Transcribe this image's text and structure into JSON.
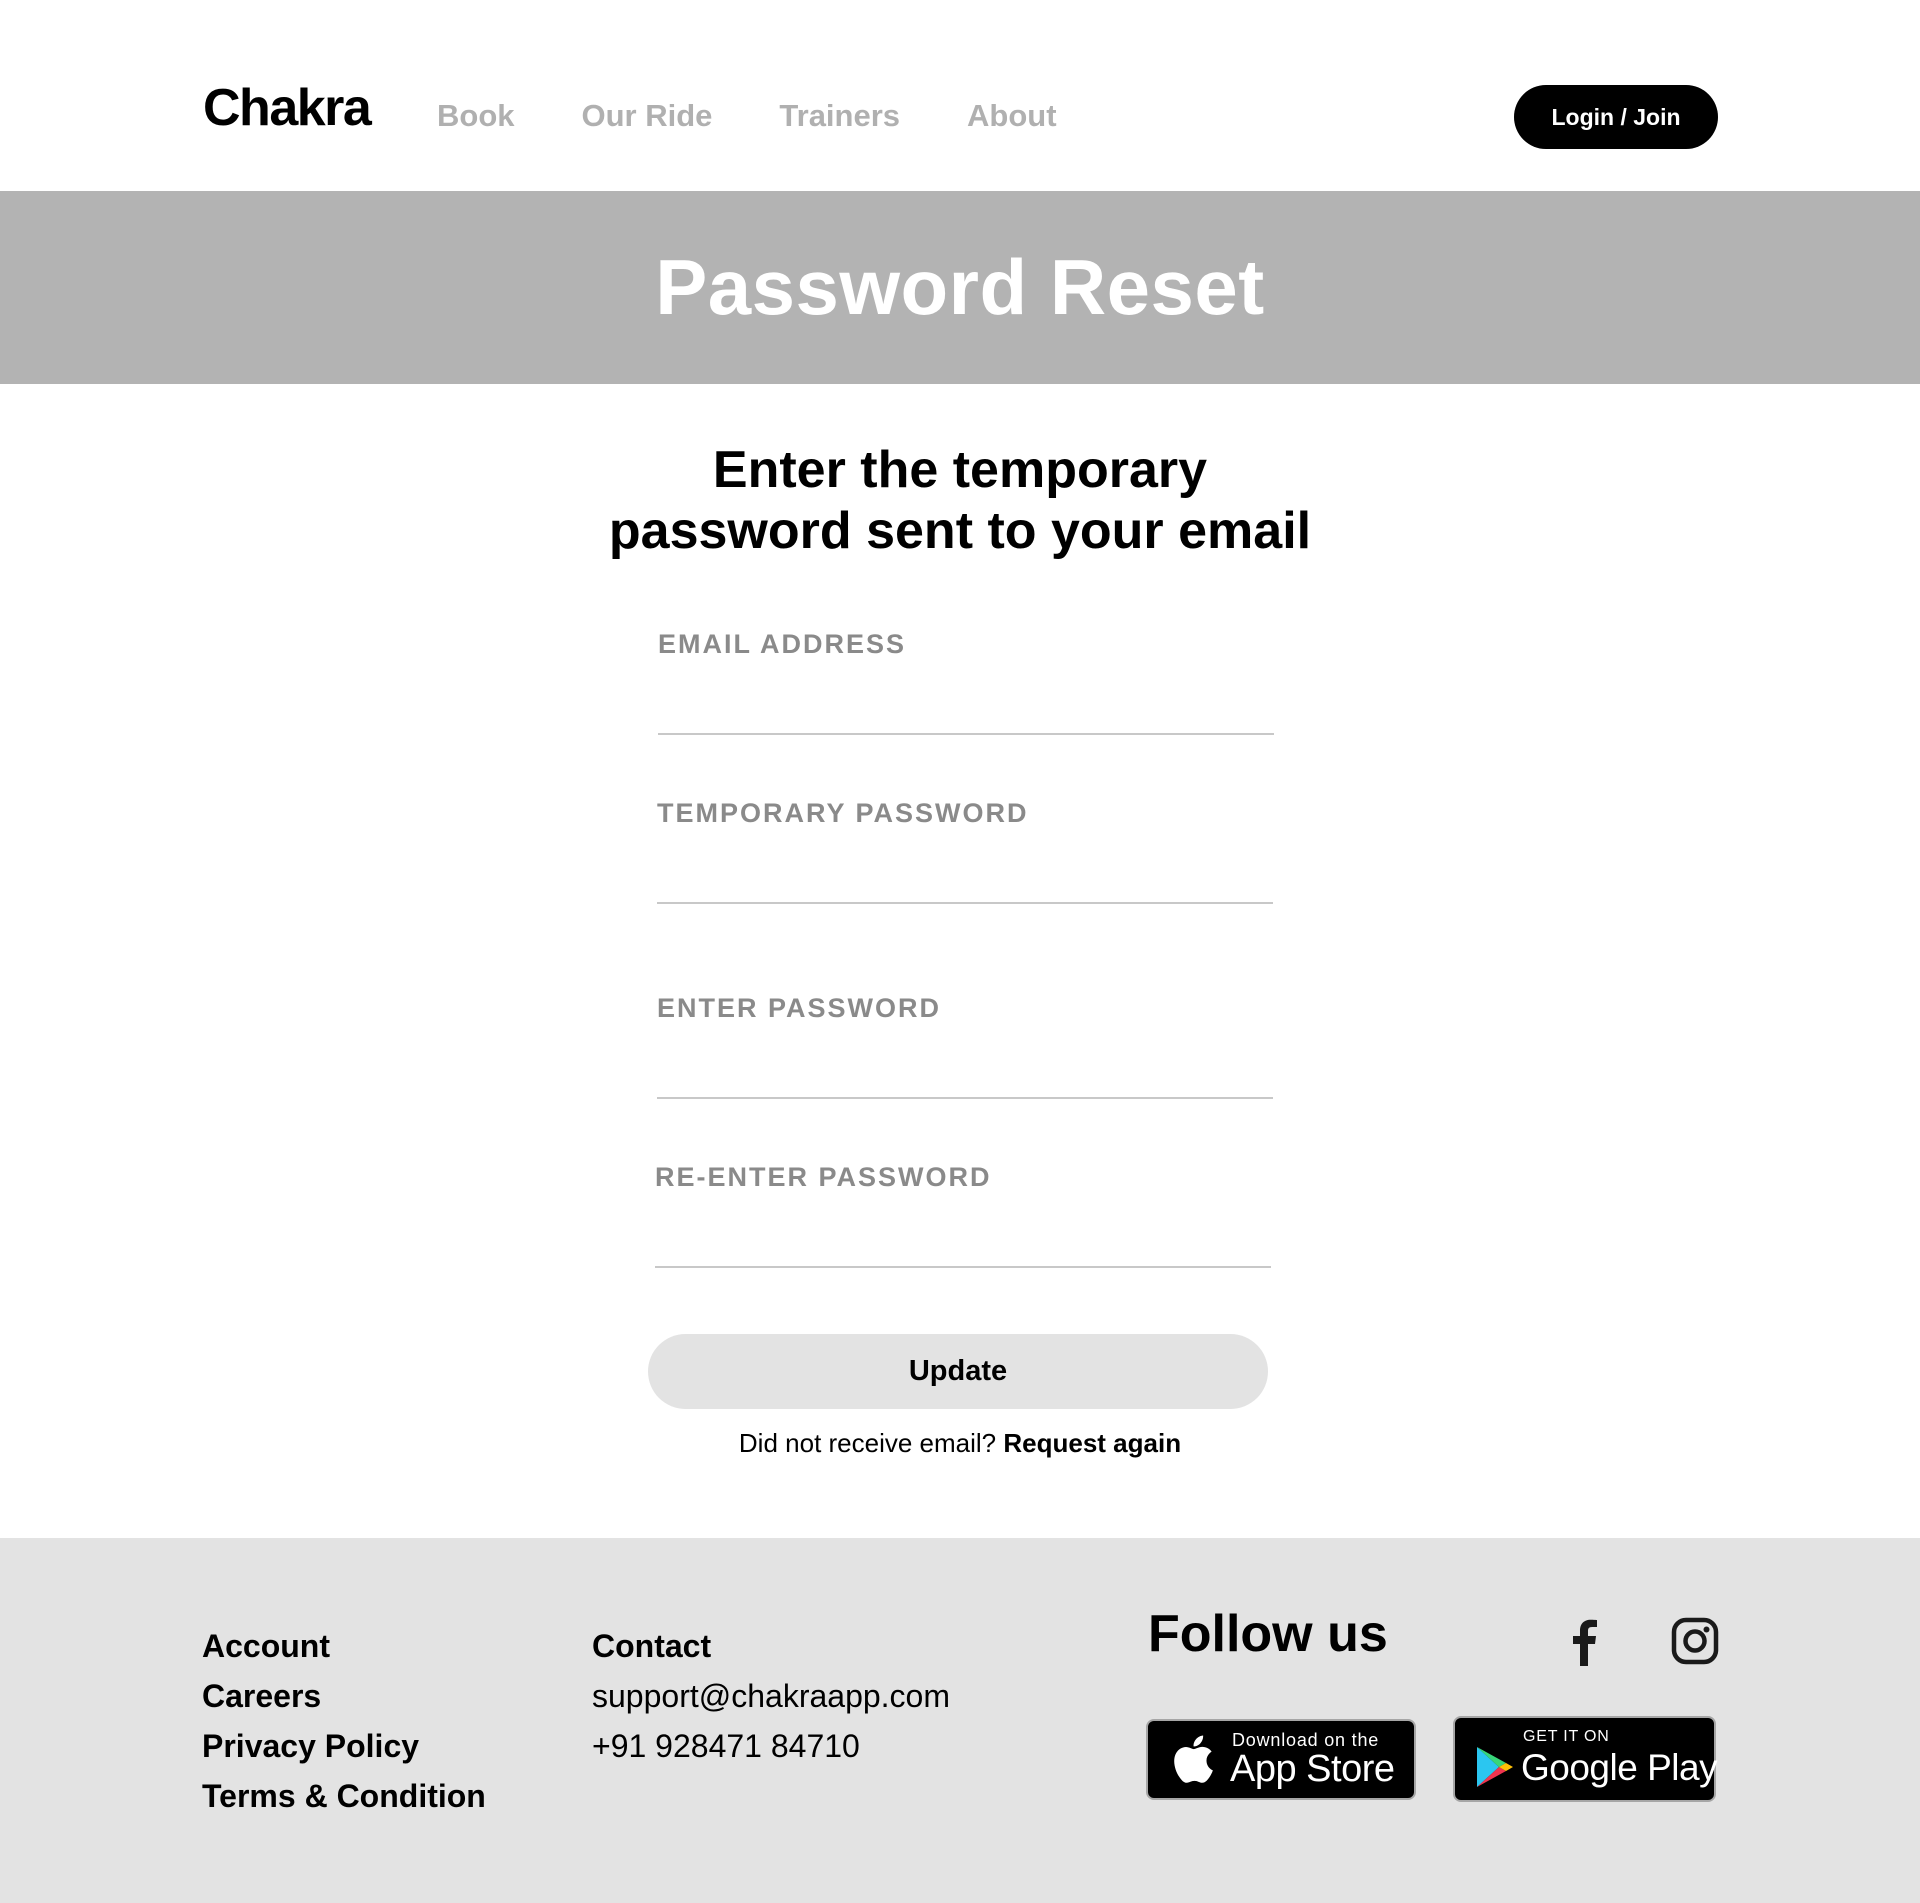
{
  "header": {
    "logo": "Chakra",
    "nav": [
      "Book",
      "Our Ride",
      "Trainers",
      "About"
    ],
    "login_label": "Login / Join"
  },
  "hero": {
    "title": "Password Reset"
  },
  "form": {
    "subtitle_line1": "Enter the temporary",
    "subtitle_line2": "password sent to your email",
    "fields": [
      {
        "label": "EMAIL ADDRESS",
        "value": ""
      },
      {
        "label": "TEMPORARY PASSWORD",
        "value": ""
      },
      {
        "label": "ENTER PASSWORD",
        "value": ""
      },
      {
        "label": "RE-ENTER PASSWORD",
        "value": ""
      }
    ],
    "submit_label": "Update",
    "resend_text": "Did not receive email?",
    "resend_link": "Request again"
  },
  "footer": {
    "account_links": [
      "Account",
      "Careers",
      "Privacy Policy",
      "Terms & Condition"
    ],
    "contact_heading": "Contact",
    "contact_email": "support@chakraapp.com",
    "contact_phone": "+91 928471 84710",
    "follow_heading": "Follow us",
    "social_icons": [
      "facebook-icon",
      "instagram-icon"
    ],
    "app_store": {
      "small": "Download on the",
      "big": "App Store"
    },
    "google_play": {
      "small": "GET IT ON",
      "big": "Google Play"
    }
  },
  "colors": {
    "hero_bg": "#b3b3b3",
    "footer_bg": "#e3e3e3",
    "nav_inactive": "#b0b0b0",
    "label_gray": "#8a8a8a",
    "button_light": "#e3e3e3",
    "button_dark": "#000000"
  }
}
